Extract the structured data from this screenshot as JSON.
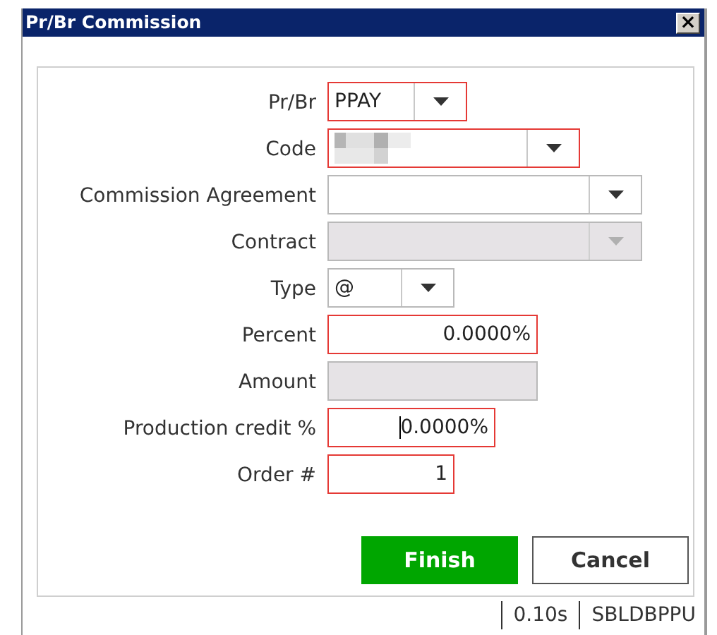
{
  "window": {
    "title": "Pr/Br Commission",
    "close": "×"
  },
  "fields": [
    {
      "kind": "dropdown",
      "label": "Pr/Br",
      "value": "PPAY",
      "required": true,
      "disabled": false
    },
    {
      "kind": "dropdown",
      "label": "Code",
      "redacted": true,
      "required": true,
      "disabled": false
    },
    {
      "kind": "dropdown",
      "label": "Commission Agreement",
      "required": false,
      "disabled": false
    },
    {
      "kind": "dropdown",
      "label": "Contract",
      "required": false,
      "disabled": true
    },
    {
      "kind": "dropdown",
      "label": "Type",
      "value": "@",
      "required": false,
      "disabled": false
    },
    {
      "kind": "text",
      "label": "Percent",
      "value": "0.0000%",
      "required": true,
      "disabled": false
    },
    {
      "kind": "text",
      "label": "Amount",
      "required": false,
      "disabled": true
    },
    {
      "kind": "text",
      "label": "Production credit %",
      "value": "0.0000%",
      "required": true,
      "disabled": false,
      "focused": true
    },
    {
      "kind": "text",
      "label": "Order #",
      "value": "1",
      "required": true,
      "disabled": false
    }
  ],
  "buttons": [
    {
      "label": "Finish",
      "primary": true
    },
    {
      "label": "Cancel",
      "primary": false
    }
  ],
  "status_bar": [
    "0.10s",
    "SBLDBPPU"
  ]
}
